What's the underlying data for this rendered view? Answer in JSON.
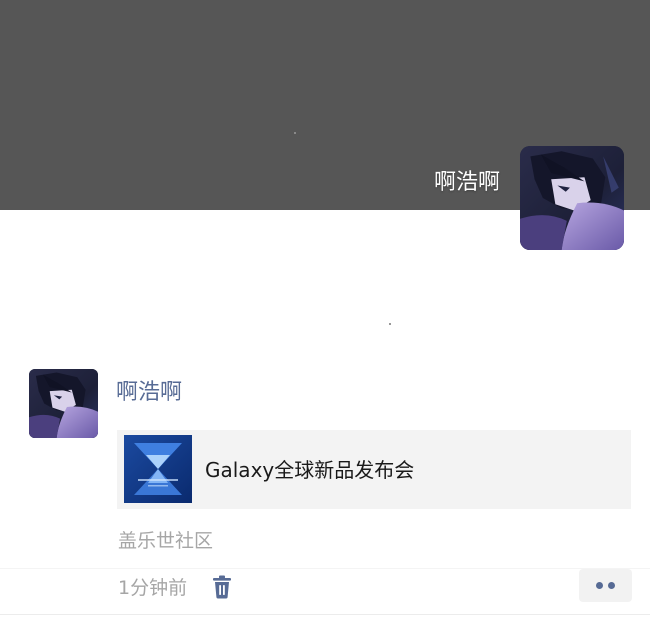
{
  "cover": {
    "username": "啊浩啊",
    "background_color": "#565656",
    "avatar": "anime-avatar"
  },
  "post": {
    "author": "啊浩啊",
    "avatar": "anime-avatar",
    "link": {
      "title": "Galaxy全球新品发布会",
      "thumbnail": "galaxy-event-thumbnail"
    },
    "source": "盖乐世社区",
    "time": "1分钟前",
    "delete_icon": "trash-icon",
    "more_icon": "more-dots-icon"
  },
  "colors": {
    "author_name": "#576b95",
    "meta_text": "#a6a6a6",
    "card_background": "#f3f3f3"
  }
}
